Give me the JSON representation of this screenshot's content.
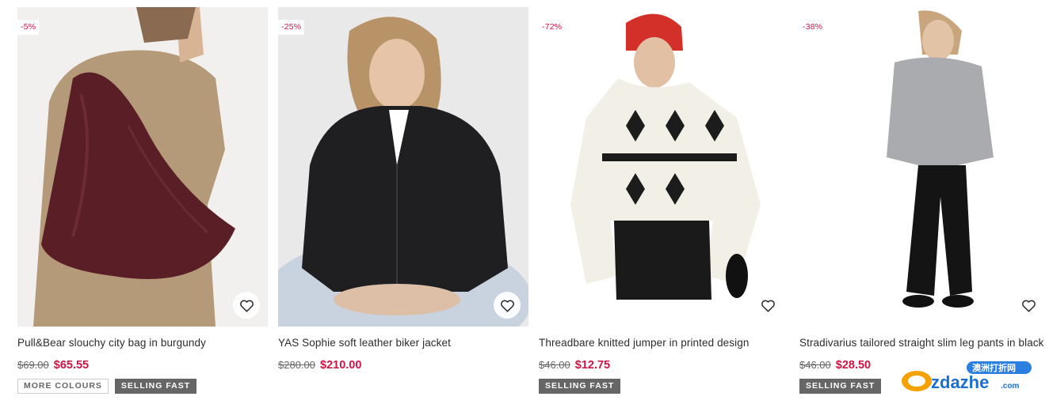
{
  "products": [
    {
      "badge": "-5%",
      "title": "Pull&Bear slouchy city bag in burgundy",
      "old_price": "$69.00",
      "price": "$65.55",
      "tags": [
        "MORE COLOURS",
        "SELLING FAST"
      ]
    },
    {
      "badge": "-25%",
      "title": "YAS Sophie soft leather biker jacket",
      "old_price": "$280.00",
      "price": "$210.00",
      "tags": []
    },
    {
      "badge": "-72%",
      "title": "Threadbare knitted jumper in printed design",
      "old_price": "$46.00",
      "price": "$12.75",
      "tags": [
        "SELLING FAST"
      ]
    },
    {
      "badge": "-38%",
      "title": "Stradivarius tailored straight slim leg pants in black",
      "old_price": "$46.00",
      "price": "$28.50",
      "tags": [
        "SELLING FAST"
      ]
    }
  ],
  "icons": {
    "save": "heart-outline-icon"
  },
  "colors": {
    "sale": "#d01345",
    "tag_dark": "#666666"
  },
  "watermark": {
    "site": "ozdazhe",
    "domain": ".com",
    "chinese": "澳洲打折网"
  }
}
